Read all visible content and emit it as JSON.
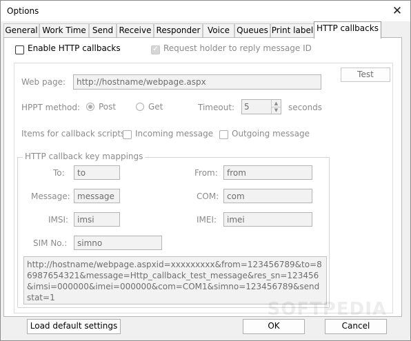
{
  "window": {
    "title": "Options"
  },
  "tabs": [
    {
      "label": "General"
    },
    {
      "label": "Work Time"
    },
    {
      "label": "Send"
    },
    {
      "label": "Receive"
    },
    {
      "label": "Responder"
    },
    {
      "label": "Voice"
    },
    {
      "label": "Queues"
    },
    {
      "label": "Print label"
    },
    {
      "label": "HTTP callbacks",
      "active": true
    }
  ],
  "http": {
    "enable_label": "Enable HTTP callbacks",
    "request_holder_label": "Request holder to reply message ID",
    "test_button": "Test",
    "web_page_label": "Web page:",
    "web_page_value": "http://hostname/webpage.aspx",
    "method_label": "HPPT method:",
    "post_label": "Post",
    "get_label": "Get",
    "timeout_label": "Timeout:",
    "timeout_value": "5",
    "seconds_label": "seconds",
    "items_label": "Items for callback scripts:",
    "incoming_label": "Incoming message",
    "outgoing_label": "Outgoing message",
    "mappings_title": "HTTP callback key mappings",
    "mappings": {
      "to_label": "To:",
      "to_value": "to",
      "from_label": "From:",
      "from_value": "from",
      "message_label": "Message:",
      "message_value": "message",
      "com_label": "COM:",
      "com_value": "com",
      "imsi_label": "IMSI:",
      "imsi_value": "imsi",
      "imei_label": "IMEI:",
      "imei_value": "imei",
      "sim_label": "SIM No.:",
      "sim_value": "simno"
    },
    "preview": "http://hostname/webpage.aspxid=xxxxxxxxx&from=123456789&to=86987654321&message=Http_callback_test_message&res_sn=123456&imsi=000000&imei=000000&com=COM1&simno=123456789&sendstat=1"
  },
  "footer": {
    "load_defaults": "Load default settings",
    "ok": "OK",
    "cancel": "Cancel"
  },
  "watermark": "SOFTPEDIA"
}
